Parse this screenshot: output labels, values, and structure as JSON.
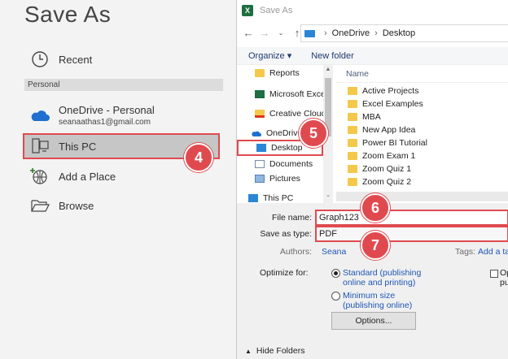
{
  "backstage": {
    "title": "Save As",
    "recent_label": "Recent",
    "section_label": "Personal",
    "onedrive_label": "OneDrive - Personal",
    "onedrive_email": "seanaathas1@gmail.com",
    "thispc_label": "This PC",
    "addplace_label": "Add a Place",
    "browse_label": "Browse"
  },
  "badges": {
    "b4": "4",
    "b5": "5",
    "b6": "6",
    "b7": "7"
  },
  "dialog": {
    "title": "Save As",
    "address": {
      "root": "OneDrive",
      "current": "Desktop"
    },
    "toolbar": {
      "organize": "Organize ▾",
      "new_folder": "New folder"
    },
    "nav_items": [
      {
        "label": "Reports",
        "icon": "folder-icon"
      },
      {
        "label": "Microsoft Excel",
        "icon": "excel-icon"
      },
      {
        "label": "Creative Cloud Fil",
        "icon": "creative-cloud-icon"
      },
      {
        "label": "OneDrive",
        "icon": "cloud-icon"
      },
      {
        "label": "Desktop",
        "icon": "desktop-icon"
      },
      {
        "label": "Documents",
        "icon": "documents-icon"
      },
      {
        "label": "Pictures",
        "icon": "pictures-icon"
      },
      {
        "label": "This PC",
        "icon": "pc-icon"
      }
    ],
    "list_header": "Name",
    "files": [
      "Active Projects",
      "Excel Examples",
      "MBA",
      "New App Idea",
      "Power BI Tutorial",
      "Zoom Exam 1",
      "Zoom Quiz 1",
      "Zoom Quiz 2"
    ],
    "form": {
      "filename_label": "File name:",
      "filename_value": "Graph123",
      "savetype_label": "Save as type:",
      "savetype_value": "PDF",
      "authors_label": "Authors:",
      "authors_value": "Seana",
      "tags_label": "Tags:",
      "tags_value": "Add a tag",
      "optimize_label": "Optimize for:",
      "opt_standard_1": "Standard (publishing",
      "opt_standard_2": "online and printing)",
      "opt_minimum_1": "Minimum size",
      "opt_minimum_2": "(publishing online)",
      "opt_check_1": "Op",
      "opt_check_2": "pu",
      "options_button": "Options...",
      "hide_folders": "Hide Folders"
    }
  },
  "colors": {
    "accent_red": "#e04a4f",
    "excel_green": "#1d6f42",
    "onedrive_blue": "#2b86d6",
    "folder_yellow": "#f4c84b"
  }
}
